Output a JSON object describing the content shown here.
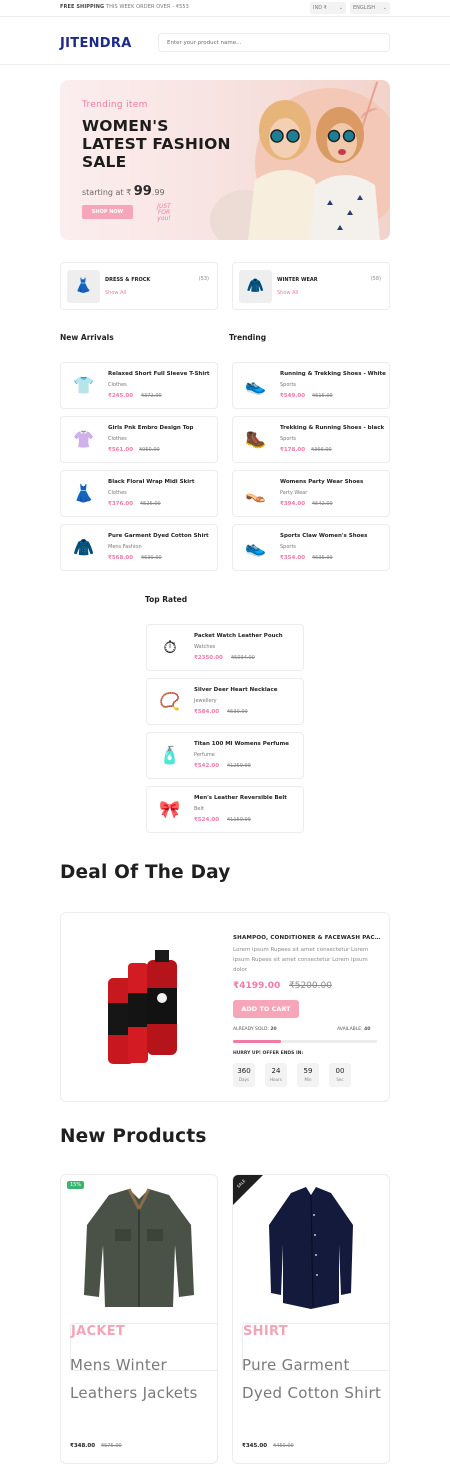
{
  "topbar": {
    "shipping_bold": "FREE SHIPPING",
    "shipping_rest": " THIS WEEK ORDER OVER - ₹553",
    "currency": "IND ₹",
    "language": "ENGLISH"
  },
  "header": {
    "logo": "JITENDRA",
    "search_placeholder": "Enter your product name..."
  },
  "banner": {
    "subtitle": "Trending item",
    "title": "WOMEN'S LATEST FASHION SALE",
    "price_prefix": "starting at ₹",
    "price_main": "99",
    "price_cents": ".99",
    "button": "SHOP NOW",
    "tag": "JUST FOR you!"
  },
  "categories": [
    {
      "name": "DRESS & FROCK",
      "count": "(53)",
      "link": "Show All",
      "icon": "dress-icon",
      "glyph": "👗"
    },
    {
      "name": "WINTER WEAR",
      "count": "(58)",
      "link": "Show All",
      "icon": "jacket-icon",
      "glyph": "🧥"
    }
  ],
  "sections": {
    "new_arrivals": "New Arrivals",
    "trending": "Trending",
    "top_rated": "Top Rated"
  },
  "new_arrivals": [
    {
      "name": "Relaxed Short Full Sleeve T-Shirt",
      "category": "Clothes",
      "price": "₹245.00",
      "old": "₹372.00",
      "glyph": "👕"
    },
    {
      "name": "Girls Pnk Embro Design Top",
      "category": "Clothes",
      "price": "₹561.00",
      "old": "₹950.00",
      "glyph": "👚"
    },
    {
      "name": "Black Floral Wrap Midi Skirt",
      "category": "Clothes",
      "price": "₹376.00",
      "old": "₹525.00",
      "glyph": "👗"
    },
    {
      "name": "Pure Garment Dyed Cotton Shirt",
      "category": "Mens Fashion",
      "price": "₹568.00",
      "old": "₹639.00",
      "glyph": "🧥"
    }
  ],
  "trending": [
    {
      "name": "Running & Trekking Shoes - White",
      "category": "Sports",
      "price": "₹549.00",
      "old": "₹615.00",
      "glyph": "👟"
    },
    {
      "name": "Trekking & Running Shoes - black",
      "category": "Sports",
      "price": "₹178.00",
      "old": "₹366.00",
      "glyph": "🥾"
    },
    {
      "name": "Womens Party Wear Shoes",
      "category": "Party Wear",
      "price": "₹394.00",
      "old": "₹542.00",
      "glyph": "👡"
    },
    {
      "name": "Sports Claw Women's Shoes",
      "category": "Sports",
      "price": "₹354.00",
      "old": "₹635.00",
      "glyph": "👟"
    }
  ],
  "top_rated": [
    {
      "name": "Packet Watch Leather Pouch",
      "category": "Watches",
      "price": "₹2350.00",
      "old": "₹5034.00",
      "glyph": "⏱"
    },
    {
      "name": "Silver Deer Heart Necklace",
      "category": "Jewellery",
      "price": "₹584.00",
      "old": "₹630.00",
      "glyph": "📿"
    },
    {
      "name": "Titan 100 Ml Womens Perfume",
      "category": "Perfume",
      "price": "₹542.00",
      "old": "₹1259.99",
      "glyph": "🧴"
    },
    {
      "name": "Men's Leather Reversible Belt",
      "category": "Belt",
      "price": "₹524.00",
      "old": "₹1159.99",
      "glyph": "🎀"
    }
  ],
  "deal": {
    "section_title": "Deal Of The Day",
    "name": "SHAMPOO, CONDITIONER & FACEWASH PACKS",
    "description": "Lorem ipsum Rupees sit amet consectetur Lorem ipsum Rupees sit amet consectetur Lorem ipsum dolor",
    "price": "₹4199.00",
    "old_price": "₹5200.00",
    "button": "ADD TO CART",
    "sold_label": "ALREADY SOLD:",
    "sold": "20",
    "available_label": "AVAILABLE:",
    "available": "40",
    "sold_fraction": 0.33,
    "hurry": "HURRY UP! OFFER ENDS IN:",
    "countdown": [
      {
        "value": "360",
        "unit": "Days"
      },
      {
        "value": "24",
        "unit": "Hours"
      },
      {
        "value": "59",
        "unit": "Min"
      },
      {
        "value": "00",
        "unit": "Sec"
      }
    ]
  },
  "new_products": {
    "section_title": "New Products",
    "items": [
      {
        "badge": "15%",
        "category": "JACKET",
        "title": "Mens Winter Leathers Jackets",
        "price": "₹348.00",
        "old": "₹575.00"
      },
      {
        "badge": "SALE",
        "category": "SHIRT",
        "title": "Pure Garment Dyed Cotton Shirt",
        "price": "₹345.00",
        "old": "₹450.00"
      }
    ]
  },
  "colors": {
    "accent": "#f07aa6",
    "brand": "#1e2a8a",
    "button": "#f6a6b8",
    "badge_green": "#3ab571"
  }
}
